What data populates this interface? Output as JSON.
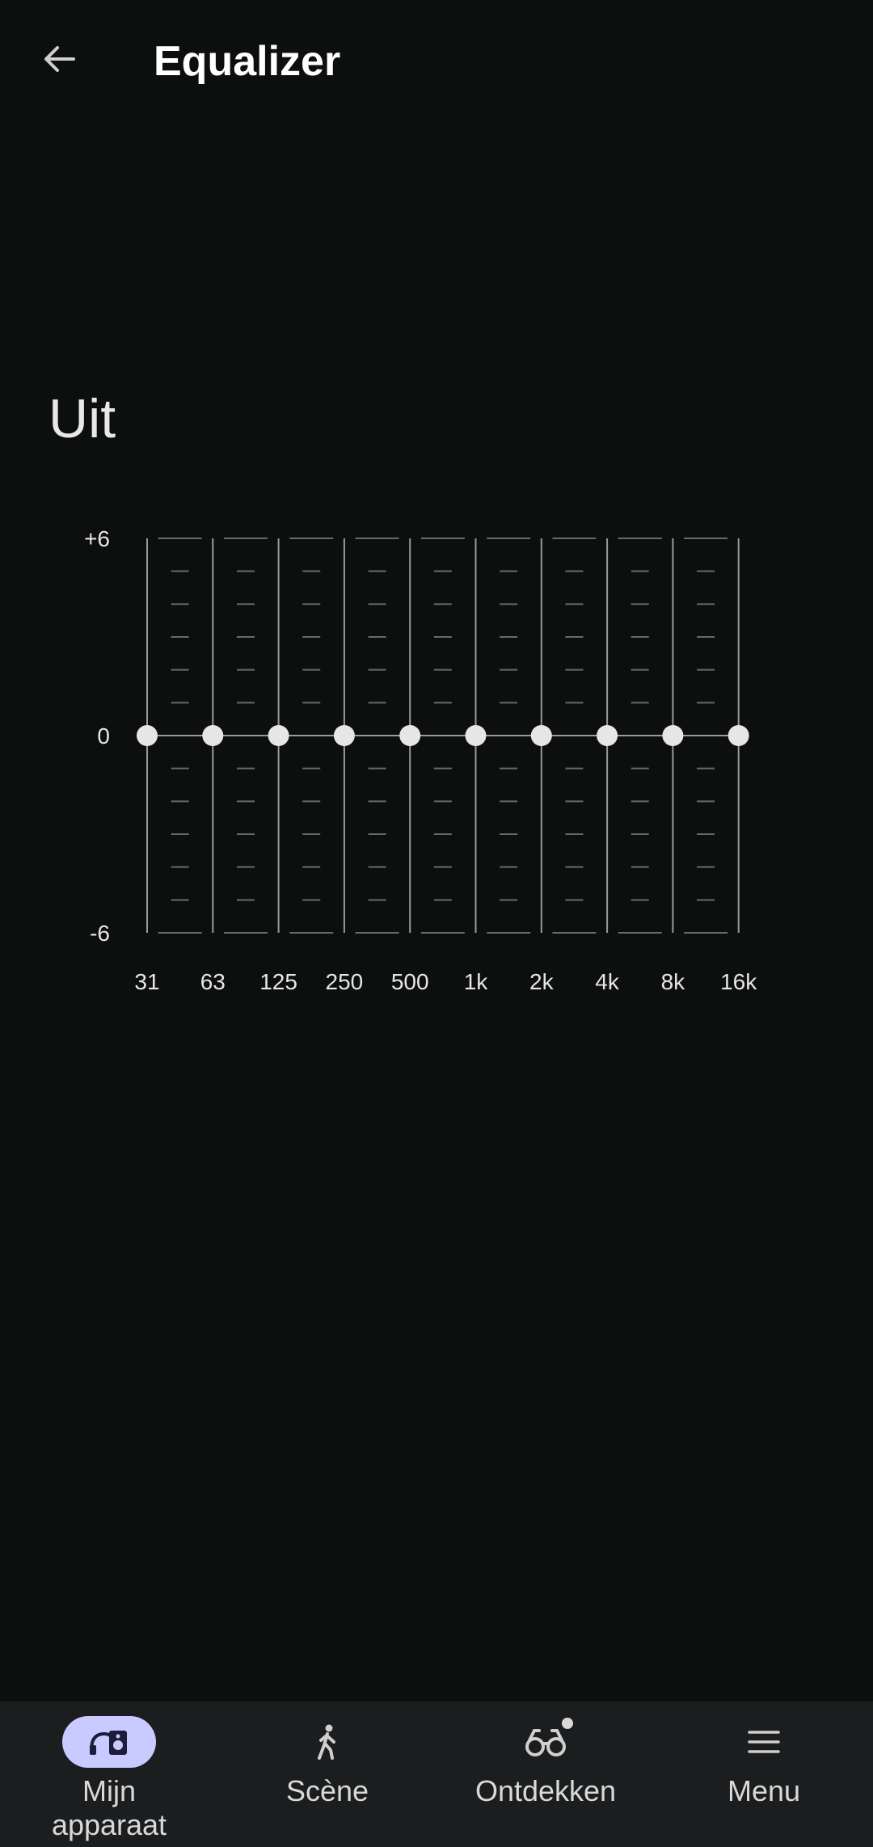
{
  "header": {
    "title": "Equalizer"
  },
  "equalizer": {
    "status": "Uit",
    "scale_labels": {
      "top": "+6",
      "middle": "0",
      "bottom": "-6"
    },
    "bands": [
      {
        "label": "31",
        "gain": 0
      },
      {
        "label": "63",
        "gain": 0
      },
      {
        "label": "125",
        "gain": 0
      },
      {
        "label": "250",
        "gain": 0
      },
      {
        "label": "500",
        "gain": 0
      },
      {
        "label": "1k",
        "gain": 0
      },
      {
        "label": "2k",
        "gain": 0
      },
      {
        "label": "4k",
        "gain": 0
      },
      {
        "label": "8k",
        "gain": 0
      },
      {
        "label": "16k",
        "gain": 0
      }
    ],
    "range": [
      -6,
      6
    ]
  },
  "bottom_nav": {
    "items": [
      {
        "label": "Mijn apparaat",
        "icon": "headphones-speaker-icon",
        "active": true
      },
      {
        "label": "Scène",
        "icon": "walking-person-icon",
        "active": false
      },
      {
        "label": "Ontdekken",
        "icon": "binoculars-icon",
        "active": false,
        "badge": true
      },
      {
        "label": "Menu",
        "icon": "menu-icon",
        "active": false
      }
    ]
  },
  "colors": {
    "background": "#0d0f0f",
    "nav_background": "#1b1d1f",
    "active_pill": "#c9caff",
    "slider_knob": "#e6e6e6",
    "line": "#9a9a9a"
  }
}
